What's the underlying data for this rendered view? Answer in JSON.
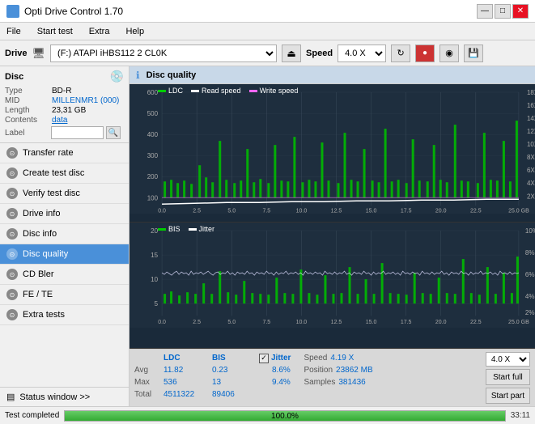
{
  "app": {
    "title": "Opti Drive Control 1.70",
    "icon": "◉"
  },
  "titlebar": {
    "minimize": "—",
    "maximize": "□",
    "close": "✕"
  },
  "menu": {
    "items": [
      "File",
      "Start test",
      "Extra",
      "Help"
    ]
  },
  "drive_bar": {
    "label": "Drive",
    "drive_value": "(F:)  ATAPI iHBS112  2 CL0K",
    "eject_icon": "⏏",
    "speed_label": "Speed",
    "speed_value": "4.0 X",
    "icon1": "↻",
    "icon2": "●",
    "icon3": "⬛",
    "icon4": "💾"
  },
  "disc": {
    "title": "Disc",
    "icon": "💿",
    "fields": {
      "type_label": "Type",
      "type_value": "BD-R",
      "mid_label": "MID",
      "mid_value": "MILLENMR1 (000)",
      "length_label": "Length",
      "length_value": "23,31 GB",
      "contents_label": "Contents",
      "contents_value": "data",
      "label_label": "Label",
      "label_value": ""
    }
  },
  "nav_items": [
    {
      "id": "transfer-rate",
      "label": "Transfer rate",
      "active": false
    },
    {
      "id": "create-test-disc",
      "label": "Create test disc",
      "active": false
    },
    {
      "id": "verify-test-disc",
      "label": "Verify test disc",
      "active": false
    },
    {
      "id": "drive-info",
      "label": "Drive info",
      "active": false
    },
    {
      "id": "disc-info",
      "label": "Disc info",
      "active": false
    },
    {
      "id": "disc-quality",
      "label": "Disc quality",
      "active": true
    },
    {
      "id": "cd-bler",
      "label": "CD Bler",
      "active": false
    },
    {
      "id": "fe-te",
      "label": "FE / TE",
      "active": false
    },
    {
      "id": "extra-tests",
      "label": "Extra tests",
      "active": false
    }
  ],
  "status_window": {
    "label": "Status window >>",
    "icon": "▤"
  },
  "chart": {
    "title": "Disc quality",
    "icon": "ℹ",
    "top": {
      "legend": [
        {
          "label": "LDC",
          "color": "#00cc00"
        },
        {
          "label": "Read speed",
          "color": "#ffffff"
        },
        {
          "label": "Write speed",
          "color": "#ff66ff"
        }
      ],
      "y_max": 600,
      "y_labels_left": [
        "600",
        "500",
        "400",
        "300",
        "200",
        "100",
        "0"
      ],
      "y_labels_right": [
        "18X",
        "16X",
        "14X",
        "12X",
        "10X",
        "8X",
        "6X",
        "4X",
        "2X"
      ],
      "x_labels": [
        "0.0",
        "2.5",
        "5.0",
        "7.5",
        "10.0",
        "12.5",
        "15.0",
        "17.5",
        "20.0",
        "22.5",
        "25.0 GB"
      ]
    },
    "bottom": {
      "legend": [
        {
          "label": "BIS",
          "color": "#00cc00"
        },
        {
          "label": "Jitter",
          "color": "#ffffff"
        }
      ],
      "y_labels_left": [
        "20",
        "15",
        "10",
        "5",
        "0"
      ],
      "y_labels_right": [
        "10%",
        "8%",
        "6%",
        "4%",
        "2%"
      ],
      "x_labels": [
        "0.0",
        "2.5",
        "5.0",
        "7.5",
        "10.0",
        "12.5",
        "15.0",
        "17.5",
        "20.0",
        "22.5",
        "25.0 GB"
      ]
    }
  },
  "stats": {
    "headers": [
      "",
      "LDC",
      "BIS"
    ],
    "rows": [
      {
        "label": "Avg",
        "ldc": "11.82",
        "bis": "0.23"
      },
      {
        "label": "Max",
        "ldc": "536",
        "bis": "13"
      },
      {
        "label": "Total",
        "ldc": "4511322",
        "bis": "89406"
      }
    ],
    "jitter": {
      "checked": true,
      "label": "Jitter",
      "value": "8.6%",
      "max_label": "",
      "max_value": "9.4%",
      "total_label": ""
    },
    "speed": {
      "label": "Speed",
      "value": "4.19 X",
      "select": "4.0 X"
    },
    "position": {
      "label": "Position",
      "value": "23862 MB"
    },
    "samples": {
      "label": "Samples",
      "value": "381436"
    },
    "buttons": {
      "start_full": "Start full",
      "start_part": "Start part"
    }
  },
  "progress": {
    "status_text": "Test completed",
    "percent": 100,
    "percent_text": "100.0%",
    "time": "33:11"
  }
}
